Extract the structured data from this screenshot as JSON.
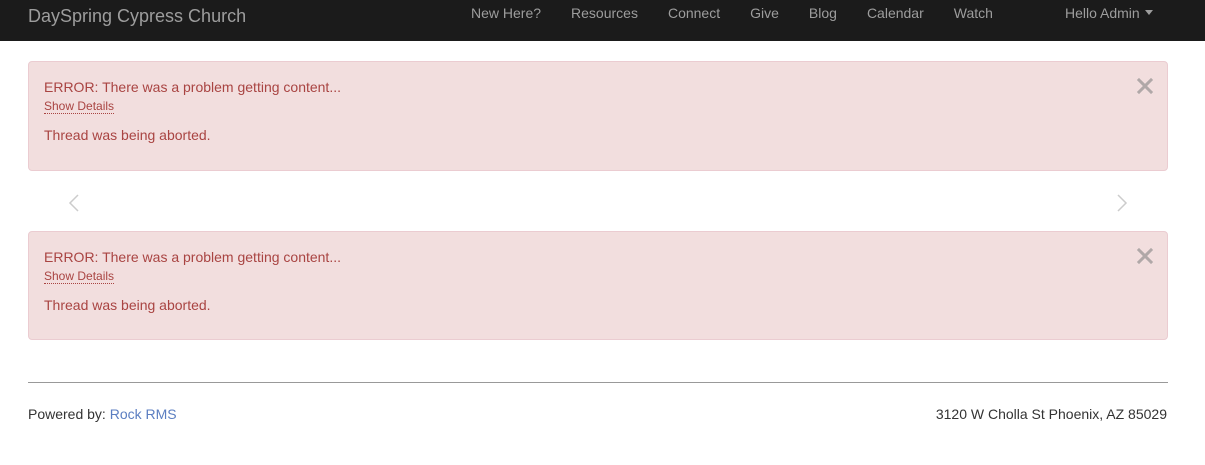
{
  "header": {
    "brand": "DaySpring Cypress Church",
    "nav_items": [
      "New Here?",
      "Resources",
      "Connect",
      "Give",
      "Blog",
      "Calendar",
      "Watch"
    ],
    "user_menu_label": "Hello Admin"
  },
  "alerts": [
    {
      "title": "ERROR: There was a problem getting content...",
      "details_link": "Show Details",
      "message": "Thread was being aborted."
    },
    {
      "title": "ERROR: There was a problem getting content...",
      "details_link": "Show Details",
      "message": "Thread was being aborted."
    }
  ],
  "footer": {
    "powered_by_label": "Powered by:",
    "powered_by_link": "Rock RMS",
    "address": "3120 W Cholla St Phoenix, AZ 85029"
  },
  "colors": {
    "navbar_bg": "#1b1b1b",
    "alert_bg": "#f2dede",
    "alert_text": "#a94442",
    "link": "#5b7ec1"
  },
  "icons": {
    "close": "close-icon",
    "prev": "chevron-left-icon",
    "next": "chevron-right-icon",
    "caret": "caret-down-icon"
  }
}
